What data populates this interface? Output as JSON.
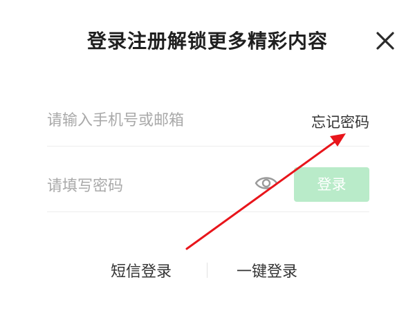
{
  "header": {
    "title": "登录注册解锁更多精彩内容",
    "close_icon": "close-icon"
  },
  "form": {
    "account_placeholder": "请输入手机号或邮箱",
    "forgot_password": "忘记密码",
    "password_placeholder": "请填写密码",
    "eye_icon": "eye-icon",
    "login_button": "登录"
  },
  "footer": {
    "sms_login": "短信登录",
    "one_click_login": "一键登录"
  },
  "colors": {
    "login_button_bg": "#b9ebc9",
    "annotation_arrow": "#e8151b"
  }
}
